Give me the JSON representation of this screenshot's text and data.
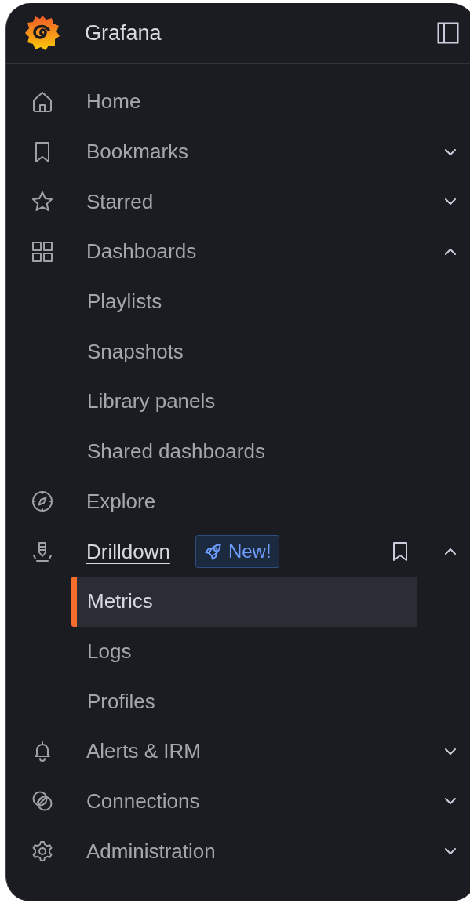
{
  "header": {
    "title": "Grafana"
  },
  "nav": [
    {
      "label": "Home",
      "active": false
    },
    {
      "label": "Bookmarks",
      "active": false,
      "expanded": false
    },
    {
      "label": "Starred",
      "active": false,
      "expanded": false
    },
    {
      "label": "Dashboards",
      "active": false,
      "expanded": true,
      "children": [
        {
          "label": "Playlists",
          "selected": false
        },
        {
          "label": "Snapshots",
          "selected": false
        },
        {
          "label": "Library panels",
          "selected": false
        },
        {
          "label": "Shared dashboards",
          "selected": false
        }
      ]
    },
    {
      "label": "Explore",
      "active": false
    },
    {
      "label": "Drilldown",
      "active": true,
      "expanded": true,
      "badge": "New!",
      "bookmark_button": true,
      "children": [
        {
          "label": "Metrics",
          "selected": true
        },
        {
          "label": "Logs",
          "selected": false
        },
        {
          "label": "Profiles",
          "selected": false
        }
      ]
    },
    {
      "label": "Alerts & IRM",
      "active": false,
      "expanded": false
    },
    {
      "label": "Connections",
      "active": false,
      "expanded": false
    },
    {
      "label": "Administration",
      "active": false,
      "expanded": false
    }
  ]
}
